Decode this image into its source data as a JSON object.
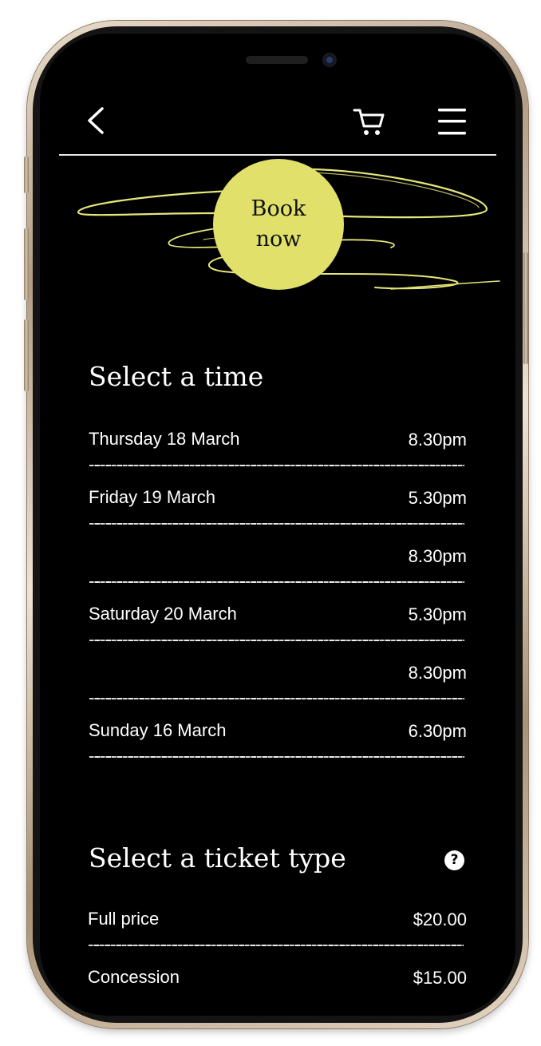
{
  "header": {
    "back_icon": "chevron-left-icon",
    "cart_icon": "cart-icon",
    "menu_icon": "hamburger-menu-icon"
  },
  "badge": {
    "line1": "Book",
    "line2": "now",
    "color": "#e0e06b"
  },
  "times": {
    "title": "Select a time",
    "rows": [
      {
        "day": "Thursday 18 March",
        "time": "8.30pm"
      },
      {
        "day": "Friday 19 March",
        "time": "5.30pm"
      },
      {
        "day": "",
        "time": "8.30pm"
      },
      {
        "day": "Saturday 20 March",
        "time": "5.30pm"
      },
      {
        "day": "",
        "time": "8.30pm"
      },
      {
        "day": "Sunday 16 March",
        "time": "6.30pm"
      }
    ]
  },
  "tickets": {
    "title": "Select a ticket type",
    "help_label": "?",
    "rows": [
      {
        "name": "Full price",
        "price": "$20.00"
      },
      {
        "name": "Concession",
        "price": "$15.00"
      }
    ]
  },
  "colors": {
    "background": "#000000",
    "accent": "#e0e06b",
    "text": "#ffffff"
  }
}
